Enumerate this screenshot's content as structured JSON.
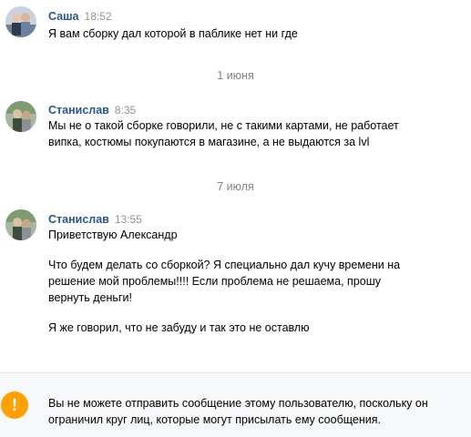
{
  "messages": [
    {
      "author": "Саша",
      "time": "18:52",
      "paragraphs": [
        "Я вам сборку дал которой в паблике нет ни где"
      ]
    },
    {
      "date": "1 июня",
      "author": "Станислав",
      "time": "8:35",
      "paragraphs": [
        "Мы не о такой сборке говорили, не с такими картами, не работает випка, костюмы покупаются в магазине, а не выдаются за lvl"
      ]
    },
    {
      "date": "7 июля",
      "author": "Станислав",
      "time": "13:55",
      "paragraphs": [
        "Приветствую Александр",
        "Что будем делать со сборкой? Я специально дал кучу времени на решение мой проблемы!!!! Если проблема не решаема, прошу вернуть деньги!",
        "Я же говорил, что не забуду и так это не оставлю"
      ]
    }
  ],
  "notice": {
    "icon": "exclamation-icon",
    "icon_glyph": "!",
    "text": "Вы не можете отправить сообщение этому пользователю, поскольку он ограничил круг лиц, которые могут присылать ему сообщения."
  },
  "colors": {
    "author": "#2a5885",
    "time": "#939393",
    "date": "#828282",
    "warning": "#ffa000"
  }
}
